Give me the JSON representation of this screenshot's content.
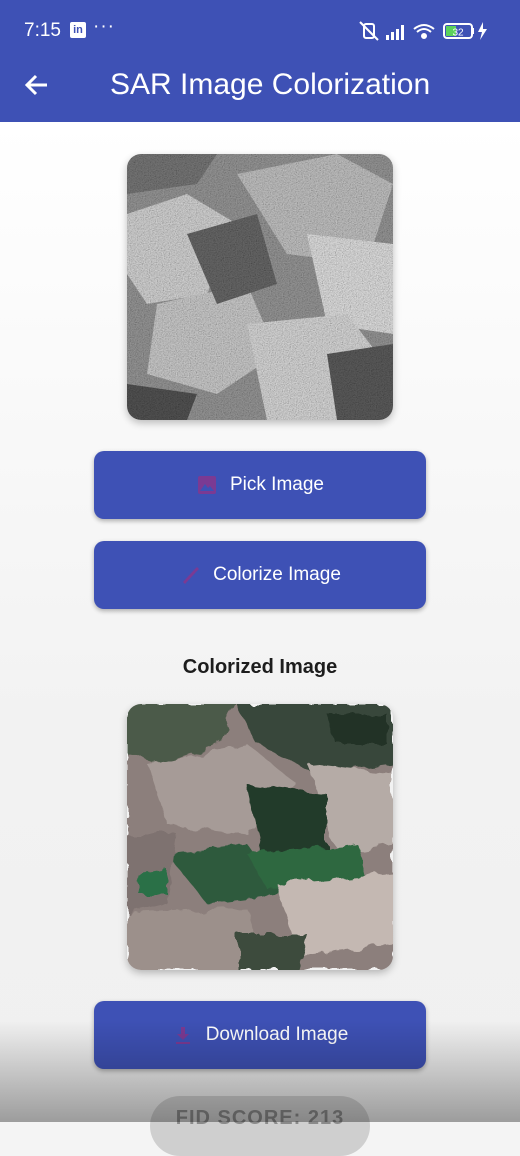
{
  "status_bar": {
    "time": "7:15",
    "linkedin_badge": "in",
    "more_dots": "···",
    "battery_level": "32"
  },
  "app_bar": {
    "title": "SAR Image Colorization",
    "back_icon": "arrow-left-icon"
  },
  "buttons": {
    "pick_image": "Pick Image",
    "colorize_image": "Colorize Image",
    "download_image": "Download Image"
  },
  "icons": {
    "pick": "image-icon",
    "colorize": "brush-icon",
    "download": "download-icon"
  },
  "result": {
    "heading": "Colorized Image"
  },
  "fid": {
    "label": "FID SCORE: 213"
  },
  "colors": {
    "primary": "#3e51b5",
    "icon_tint": "#7b3a93"
  }
}
